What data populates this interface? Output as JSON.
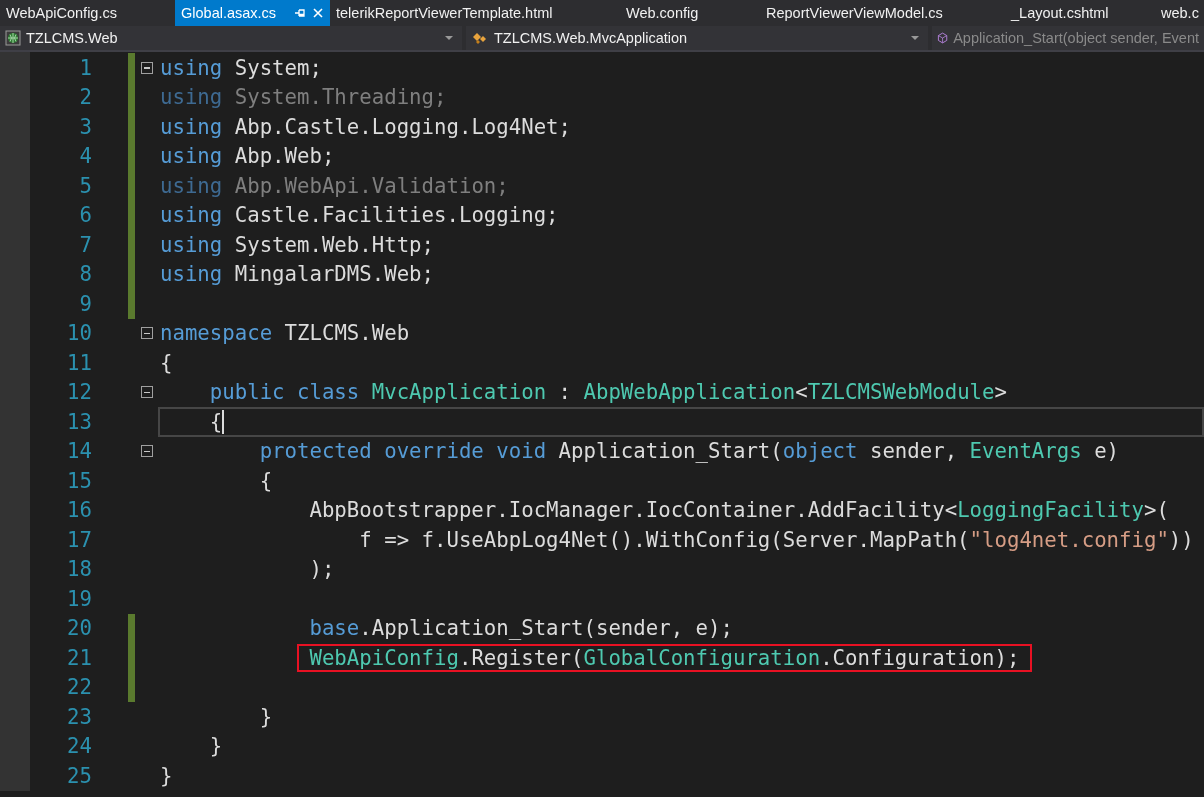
{
  "tabs": [
    {
      "label": "WebApiConfig.cs",
      "selected": false
    },
    {
      "label": "Global.asax.cs",
      "selected": true
    },
    {
      "label": "telerikReportViewerTemplate.html",
      "selected": false
    },
    {
      "label": "Web.config",
      "selected": false
    },
    {
      "label": "ReportViewerViewModel.cs",
      "selected": false
    },
    {
      "label": "_Layout.cshtml",
      "selected": false
    },
    {
      "label": "web.c",
      "selected": false
    }
  ],
  "navigation_bar": [
    {
      "kind": "project",
      "text": "TZLCMS.Web",
      "disabled": false
    },
    {
      "kind": "class",
      "text": "TZLCMS.Web.MvcApplication",
      "disabled": false
    },
    {
      "kind": "member",
      "text": "Application_Start(object sender, Event",
      "disabled": true
    }
  ],
  "editor": {
    "lines": [
      {
        "number": "1",
        "changed": true,
        "current": false,
        "expanded": true,
        "tokens": [
          {
            "kind": "keyword",
            "t": "using "
          },
          {
            "kind": "plain",
            "t": "System;"
          }
        ]
      },
      {
        "number": "2",
        "changed": true,
        "current": false,
        "tokens": [
          {
            "kind": "unused_keyword",
            "t": "using "
          },
          {
            "kind": "unused",
            "t": "System.Threading;"
          }
        ]
      },
      {
        "number": "3",
        "changed": true,
        "current": false,
        "tokens": [
          {
            "kind": "keyword",
            "t": "using "
          },
          {
            "kind": "plain",
            "t": "Abp.Castle.Logging.Log4Net;"
          }
        ]
      },
      {
        "number": "4",
        "changed": true,
        "current": false,
        "tokens": [
          {
            "kind": "keyword",
            "t": "using "
          },
          {
            "kind": "plain",
            "t": "Abp.Web;"
          }
        ]
      },
      {
        "number": "5",
        "changed": true,
        "current": false,
        "tokens": [
          {
            "kind": "unused_keyword",
            "t": "using "
          },
          {
            "kind": "unused",
            "t": "Abp.WebApi.Validation;"
          }
        ]
      },
      {
        "number": "6",
        "changed": true,
        "current": false,
        "tokens": [
          {
            "kind": "keyword",
            "t": "using "
          },
          {
            "kind": "plain",
            "t": "Castle.Facilities.Logging;"
          }
        ]
      },
      {
        "number": "7",
        "changed": true,
        "current": false,
        "tokens": [
          {
            "kind": "keyword",
            "t": "using "
          },
          {
            "kind": "plain",
            "t": "System.Web.Http;"
          }
        ]
      },
      {
        "number": "8",
        "changed": true,
        "current": false,
        "tokens": [
          {
            "kind": "keyword",
            "t": "using "
          },
          {
            "kind": "plain",
            "t": "MingalarDMS.Web;"
          }
        ]
      },
      {
        "number": "9",
        "changed": true,
        "current": false
      },
      {
        "number": "10",
        "changed": false,
        "current": false,
        "expanded": true,
        "tokens": [
          {
            "kind": "keyword",
            "t": "namespace "
          },
          {
            "kind": "plain",
            "t": "TZLCMS.Web"
          }
        ]
      },
      {
        "number": "11",
        "changed": false,
        "current": false,
        "tokens": [
          {
            "kind": "plain",
            "t": "{"
          }
        ]
      },
      {
        "number": "12",
        "changed": false,
        "current": false,
        "expanded": true,
        "tokens": [
          {
            "kind": "keyword",
            "t": "    public class "
          },
          {
            "kind": "type",
            "t": "MvcApplication"
          },
          {
            "kind": "plain",
            "t": " : "
          },
          {
            "kind": "type",
            "t": "AbpWebApplication"
          },
          {
            "kind": "plain",
            "t": "<"
          },
          {
            "kind": "type",
            "t": "TZLCMSWebModule"
          },
          {
            "kind": "plain",
            "t": ">"
          }
        ]
      },
      {
        "number": "13",
        "changed": false,
        "current": true,
        "tokens": [
          {
            "kind": "plain",
            "t": "    {"
          }
        ]
      },
      {
        "number": "14",
        "changed": false,
        "current": false,
        "expanded": true,
        "tokens": [
          {
            "kind": "keyword",
            "t": "        protected override void "
          },
          {
            "kind": "plain",
            "t": "Application_Start("
          },
          {
            "kind": "keyword",
            "t": "object "
          },
          {
            "kind": "plain",
            "t": "sender, "
          },
          {
            "kind": "type",
            "t": "EventArgs"
          },
          {
            "kind": "plain",
            "t": " e)"
          }
        ]
      },
      {
        "number": "15",
        "changed": false,
        "current": false,
        "tokens": [
          {
            "kind": "plain",
            "t": "        {"
          }
        ]
      },
      {
        "number": "16",
        "changed": false,
        "current": false,
        "tokens": [
          {
            "kind": "plain",
            "t": "            AbpBootstrapper.IocManager.IocContainer.AddFacility<"
          },
          {
            "kind": "type",
            "t": "LoggingFacility"
          },
          {
            "kind": "plain",
            "t": ">("
          }
        ]
      },
      {
        "number": "17",
        "changed": false,
        "current": false,
        "tokens": [
          {
            "kind": "plain",
            "t": "                f => f.UseAbpLog4Net().WithConfig(Server.MapPath("
          },
          {
            "kind": "string",
            "t": "\"log4net.config\""
          },
          {
            "kind": "plain",
            "t": "))"
          }
        ]
      },
      {
        "number": "18",
        "changed": false,
        "current": false,
        "tokens": [
          {
            "kind": "plain",
            "t": "            );"
          }
        ]
      },
      {
        "number": "19",
        "changed": false,
        "current": false
      },
      {
        "number": "20",
        "changed": true,
        "current": false,
        "tokens": [
          {
            "kind": "keyword",
            "t": "            base"
          },
          {
            "kind": "plain",
            "t": ".Application_Start(sender, e);"
          }
        ]
      },
      {
        "number": "21",
        "changed": true,
        "current": false,
        "highlighted": true,
        "tokens": [
          {
            "kind": "type",
            "t": "            WebApiConfig"
          },
          {
            "kind": "plain",
            "t": ".Register("
          },
          {
            "kind": "type",
            "t": "GlobalConfiguration"
          },
          {
            "kind": "plain",
            "t": ".Configuration);"
          }
        ]
      },
      {
        "number": "22",
        "changed": true,
        "current": false
      },
      {
        "number": "23",
        "changed": false,
        "current": false,
        "tokens": [
          {
            "kind": "plain",
            "t": "        }"
          }
        ]
      },
      {
        "number": "24",
        "changed": false,
        "current": false,
        "tokens": [
          {
            "kind": "plain",
            "t": "    }"
          }
        ]
      },
      {
        "number": "25",
        "changed": false,
        "current": false,
        "tokens": [
          {
            "kind": "plain",
            "t": "}"
          }
        ]
      }
    ]
  }
}
